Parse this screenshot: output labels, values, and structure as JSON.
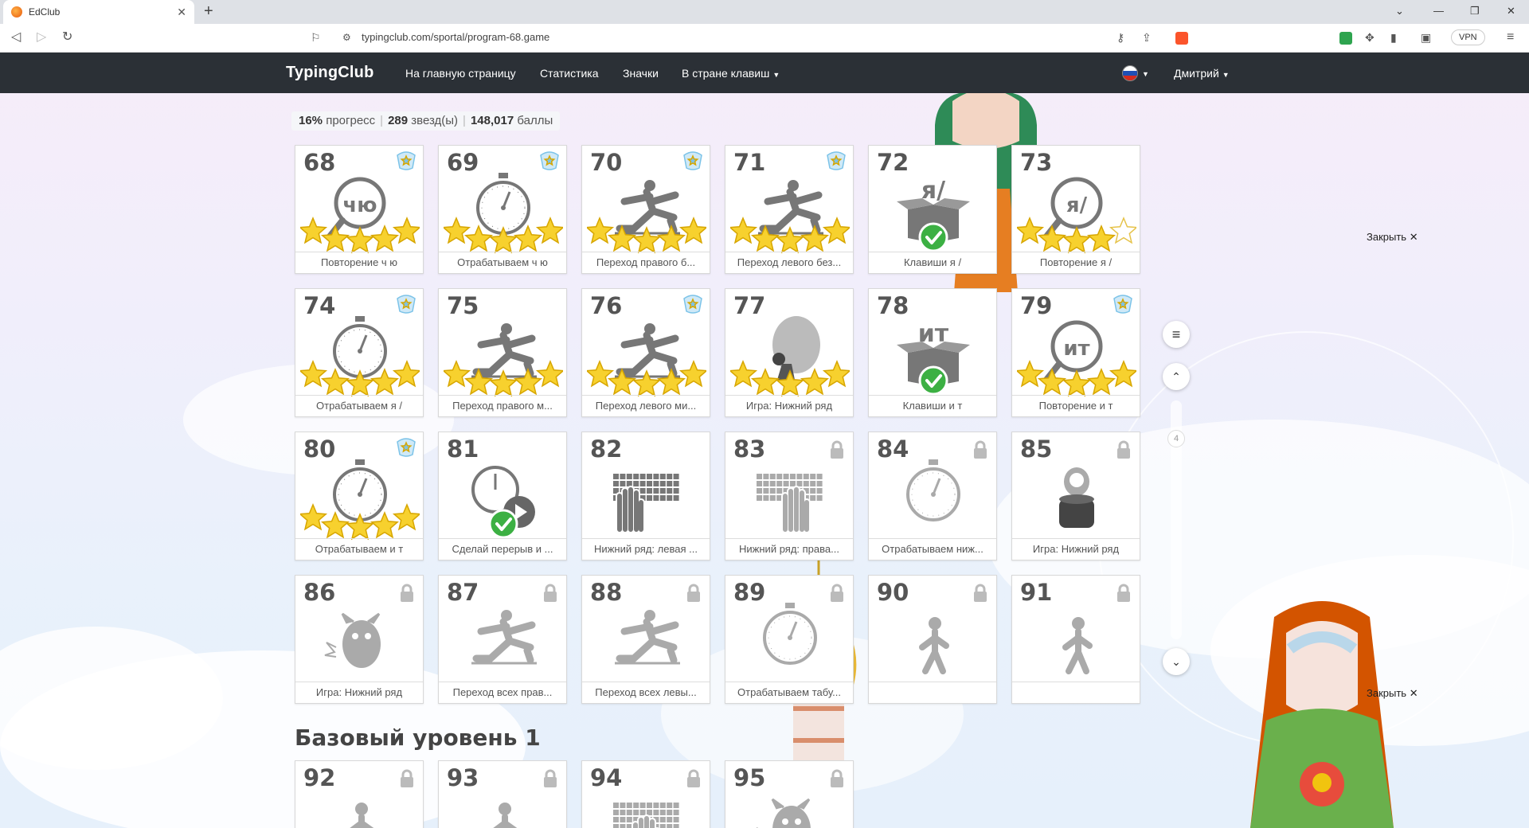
{
  "browser": {
    "tab_title": "EdClub",
    "tab_close": "✕",
    "new_tab": "+",
    "url": "typingclub.com/sportal/program-68.game",
    "vpn_label": "VPN"
  },
  "nav": {
    "logo": "TypingClub",
    "links": [
      "На главную страницу",
      "Статистика",
      "Значки",
      "В стране клавиш"
    ],
    "user": "Дмитрий"
  },
  "stats": {
    "progress_value": "16%",
    "progress_label": "прогресс",
    "stars_value": "289",
    "stars_label": "звезд(ы)",
    "points_value": "148,017",
    "points_label": "баллы"
  },
  "close_label": "Закрыть",
  "scroll_indicator": "4",
  "section_title": "Базовый уровень 1",
  "lessons": [
    {
      "num": "68",
      "label": "Повторение ч ю",
      "icon": "magnifier-text-icon",
      "glyph": "чю",
      "stars": 5,
      "badge": true,
      "lock": false
    },
    {
      "num": "69",
      "label": "Отрабатываем ч ю",
      "icon": "stopwatch-icon",
      "stars": 5,
      "badge": true,
      "lock": false
    },
    {
      "num": "70",
      "label": "Переход правого б...",
      "icon": "lunge-figure-icon",
      "stars": 5,
      "badge": true,
      "lock": false
    },
    {
      "num": "71",
      "label": "Переход левого без...",
      "icon": "lunge-figure-icon",
      "stars": 5,
      "badge": true,
      "lock": false
    },
    {
      "num": "72",
      "label": "Клавиши я /",
      "icon": "open-box-icon",
      "glyph": "я/",
      "stars": 0,
      "check": true,
      "badge": false,
      "lock": false
    },
    {
      "num": "73",
      "label": "Повторение я /",
      "icon": "magnifier-text-icon",
      "glyph": "я/",
      "stars": 4,
      "badge": false,
      "lock": false
    },
    {
      "num": "74",
      "label": "Отрабатываем я /",
      "icon": "stopwatch-icon",
      "stars": 5,
      "badge": true,
      "lock": false
    },
    {
      "num": "75",
      "label": "Переход правого м...",
      "icon": "lunge-figure-icon",
      "stars": 5,
      "badge": false,
      "lock": false
    },
    {
      "num": "76",
      "label": "Переход левого ми...",
      "icon": "lunge-figure-icon",
      "stars": 5,
      "badge": true,
      "lock": false
    },
    {
      "num": "77",
      "label": "Игра: Нижний ряд",
      "icon": "balloon-game-icon",
      "stars": 5,
      "badge": false,
      "lock": false
    },
    {
      "num": "78",
      "label": "Клавиши и т",
      "icon": "open-box-icon",
      "glyph": "ит",
      "stars": 0,
      "check": true,
      "badge": false,
      "lock": false
    },
    {
      "num": "79",
      "label": "Повторение и т",
      "icon": "magnifier-text-icon",
      "glyph": "ит",
      "stars": 5,
      "badge": true,
      "lock": false
    },
    {
      "num": "80",
      "label": "Отрабатываем и т",
      "icon": "stopwatch-icon",
      "stars": 5,
      "badge": true,
      "lock": false
    },
    {
      "num": "81",
      "label": "Сделай перерыв и ...",
      "icon": "break-video-icon",
      "stars": 0,
      "check": true,
      "badge": false,
      "lock": false
    },
    {
      "num": "82",
      "label": "Нижний ряд: левая ...",
      "icon": "keyboard-left-hand-icon",
      "stars": 0,
      "badge": false,
      "lock": false
    },
    {
      "num": "83",
      "label": "Нижний ряд: права...",
      "icon": "keyboard-right-hand-icon",
      "stars": 0,
      "badge": false,
      "lock": true
    },
    {
      "num": "84",
      "label": "Отрабатываем ниж...",
      "icon": "stopwatch-icon",
      "stars": 0,
      "badge": false,
      "lock": true
    },
    {
      "num": "85",
      "label": "Игра: Нижний ряд",
      "icon": "penguin-game-icon",
      "stars": 0,
      "badge": false,
      "lock": true
    },
    {
      "num": "86",
      "label": "Игра: Нижний ряд",
      "icon": "monster-game-icon",
      "stars": 0,
      "badge": false,
      "lock": true
    },
    {
      "num": "87",
      "label": "Переход всех прав...",
      "icon": "lunge-figure-icon",
      "stars": 0,
      "badge": false,
      "lock": true
    },
    {
      "num": "88",
      "label": "Переход всех левы...",
      "icon": "lunge-figure-icon",
      "stars": 0,
      "badge": false,
      "lock": true
    },
    {
      "num": "89",
      "label": "Отрабатываем табу...",
      "icon": "stopwatch-icon",
      "stars": 0,
      "badge": false,
      "lock": true
    },
    {
      "num": "90",
      "label": "",
      "icon": "walking-figure-icon",
      "stars": 0,
      "badge": false,
      "lock": true
    },
    {
      "num": "91",
      "label": "",
      "icon": "walking-figure-icon",
      "stars": 0,
      "badge": false,
      "lock": true
    },
    {
      "num": "92",
      "label": "",
      "icon": "walking-figure-icon",
      "stars": 0,
      "badge": false,
      "lock": true
    },
    {
      "num": "93",
      "label": "",
      "icon": "walking-figure-icon",
      "stars": 0,
      "badge": false,
      "lock": true
    },
    {
      "num": "94",
      "label": "",
      "icon": "keyboard-hands-icon",
      "stars": 0,
      "badge": false,
      "lock": true
    },
    {
      "num": "95",
      "label": "",
      "icon": "monster-game-icon",
      "stars": 0,
      "badge": false,
      "lock": true
    }
  ]
}
